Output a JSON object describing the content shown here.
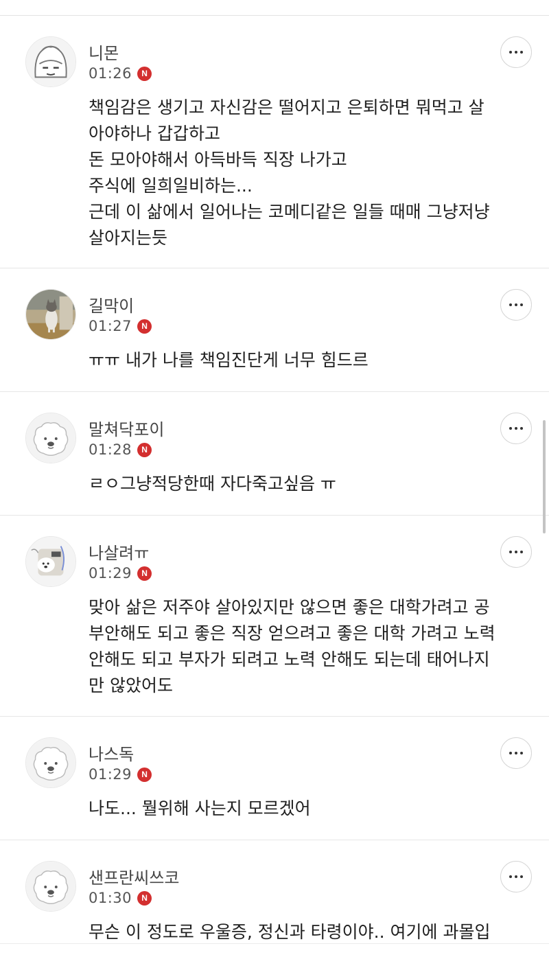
{
  "comments": [
    {
      "username": "니몬",
      "time": "01:26",
      "badge": "N",
      "text": "책임감은 생기고 자신감은 떨어지고 은퇴하면 뭐먹고 살\n아야하나 갑갑하고\n돈 모아야해서 아득바득 직장 나가고\n주식에 일희일비하는...\n근데 이 삶에서 일어나는 코메디같은 일들 때매 그냥저냥\n살아지는듯",
      "avatar": "cartoon-character-icon"
    },
    {
      "username": "길막이",
      "time": "01:27",
      "badge": "N",
      "text": "ㅠㅠ 내가 나를 책임진단게 너무 힘드르",
      "avatar": "cat-photo"
    },
    {
      "username": "말쳐닥포이",
      "time": "01:28",
      "badge": "N",
      "text": "ㄹㅇ그냥적당한때 자다죽고싶음 ㅠ",
      "avatar": "default-dog-icon"
    },
    {
      "username": "나살려ㅠ",
      "time": "01:29",
      "badge": "N",
      "text": "맞아 삶은 저주야 살아있지만 않으면 좋은 대학가려고 공\n부안해도 되고 좋은 직장 얻으려고 좋은 대학 가려고 노력\n안해도 되고 부자가 되려고 노력 안해도 되는데 태어나지\n만 않았어도",
      "avatar": "dog-photo"
    },
    {
      "username": "나스독",
      "time": "01:29",
      "badge": "N",
      "text": "나도... 뭘위해 사는지 모르겠어",
      "avatar": "default-dog-icon"
    },
    {
      "username": "샌프란씨쓰코",
      "time": "01:30",
      "badge": "N",
      "text": "무슨 이 정도로 우울증, 정신과 타령이야.. 여기에 과몰입",
      "avatar": "default-dog-icon"
    }
  ],
  "colors": {
    "badge": "#d32f2f",
    "divider": "#e6e6e6"
  }
}
